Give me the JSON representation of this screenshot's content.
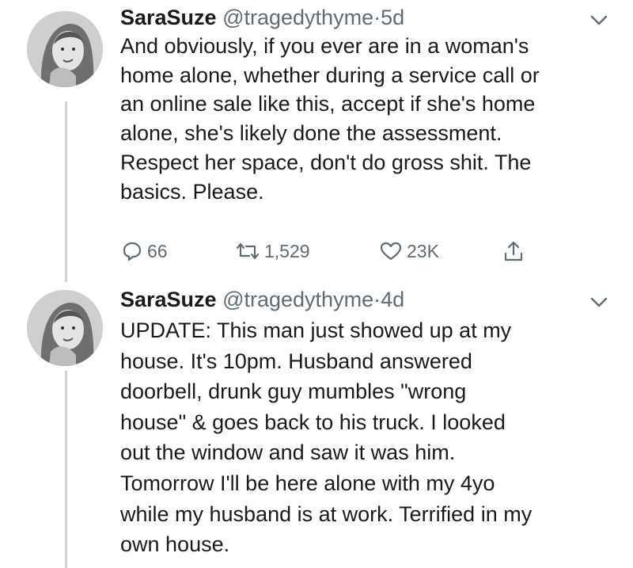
{
  "tweets": [
    {
      "name": "SaraSuze",
      "handle": "@tragedythyme",
      "separator": "·",
      "time": "5d",
      "lines": [
        "And obviously, if you ever are in a woman's",
        "home alone, whether during a service call or",
        "an online sale like this, accept if she's home",
        "alone, she's likely done the assessment.",
        "Respect her space, don't do gross shit. The",
        "basics. Please."
      ],
      "replies": "66",
      "retweets": "1,529",
      "likes": "23K"
    },
    {
      "name": "SaraSuze",
      "handle": "@tragedythyme",
      "separator": "·",
      "time": "4d",
      "lines": [
        "UPDATE: This man just showed up at my",
        "house. It's 10pm. Husband answered",
        "doorbell, drunk guy mumbles \"wrong",
        "house\" & goes back to his truck. I looked",
        "out the window and saw it was him.",
        "Tomorrow I'll be here alone with my 4yo",
        "while my husband is at work. Terrified in my",
        "own house."
      ]
    }
  ],
  "icons": {
    "reply": "reply-icon",
    "retweet": "retweet-icon",
    "like": "heart-icon",
    "share": "share-icon",
    "menu": "chevron-down-icon"
  },
  "colors": {
    "text": "#1a1a1a",
    "secondary": "#5f6b73",
    "thread_line": "#cfd3d6",
    "background": "#ffffff"
  }
}
